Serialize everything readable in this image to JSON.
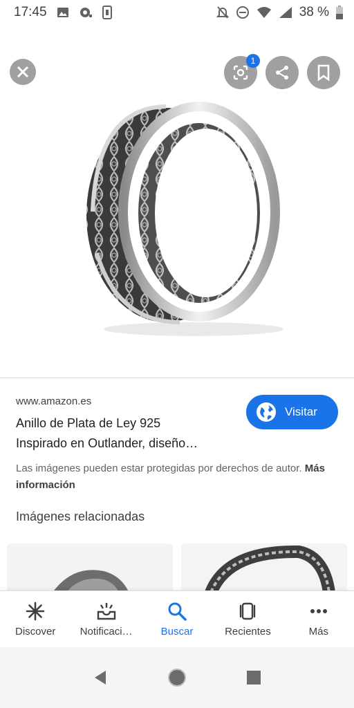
{
  "status_bar": {
    "time": "17:45",
    "battery": "38 %"
  },
  "viewer": {
    "lens_badge": "1"
  },
  "result": {
    "source": "www.amazon.es",
    "title_line1": "Anillo de Plata de Ley 925",
    "title_line2": "Inspirado en Outlander, diseño…",
    "visit_label": "Visitar",
    "copyright_text": "Las imágenes pueden estar protegidas por derechos de autor.",
    "more_info_label": "Más información",
    "related_title": "Imágenes relacionadas"
  },
  "bottom_nav": {
    "items": [
      {
        "label": "Discover"
      },
      {
        "label": "Notificaci…"
      },
      {
        "label": "Buscar"
      },
      {
        "label": "Recientes"
      },
      {
        "label": "Más"
      }
    ]
  },
  "colors": {
    "accent": "#1a73e8",
    "overlay_button": "#8a8a8a"
  }
}
